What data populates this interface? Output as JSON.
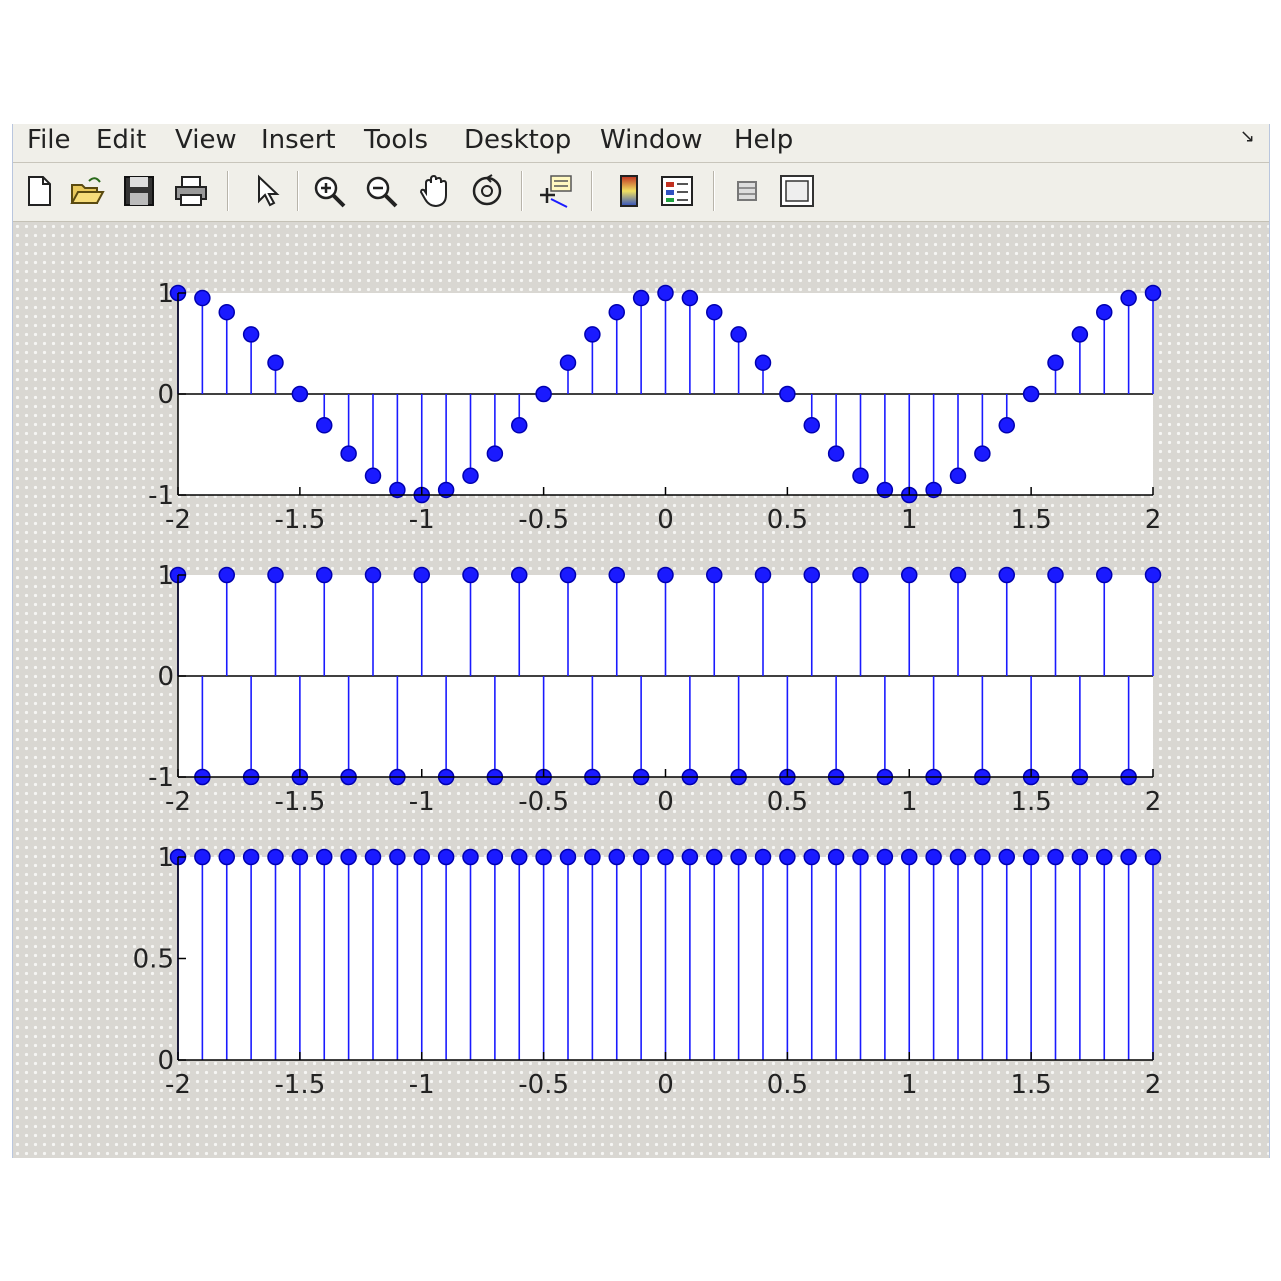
{
  "window": {
    "menu": [
      "File",
      "Edit",
      "View",
      "Insert",
      "Tools",
      "Desktop",
      "Window",
      "Help"
    ],
    "menu_corner_icon": "dock-arrow-icon"
  },
  "toolbar": {
    "buttons": [
      {
        "name": "new-figure-button",
        "icon": "new-document-icon"
      },
      {
        "name": "open-file-button",
        "icon": "open-folder-icon"
      },
      {
        "name": "save-figure-button",
        "icon": "floppy-disk-icon"
      },
      {
        "name": "print-figure-button",
        "icon": "printer-icon"
      },
      {
        "name": "edit-plot-button",
        "icon": "arrow-cursor-icon"
      },
      {
        "name": "zoom-in-button",
        "icon": "zoom-in-icon"
      },
      {
        "name": "zoom-out-button",
        "icon": "zoom-out-icon"
      },
      {
        "name": "pan-button",
        "icon": "hand-icon"
      },
      {
        "name": "rotate-3d-button",
        "icon": "rotate-icon"
      },
      {
        "name": "data-cursor-button",
        "icon": "data-cursor-icon"
      },
      {
        "name": "insert-colorbar-button",
        "icon": "colorbar-icon"
      },
      {
        "name": "insert-legend-button",
        "icon": "legend-icon"
      },
      {
        "name": "hide-plot-tools-button",
        "icon": "hide-tools-icon"
      },
      {
        "name": "show-plot-tools-button",
        "icon": "show-tools-icon"
      }
    ]
  },
  "colors": {
    "stem": "#1a1aff",
    "axes_bg": "#ffffff",
    "figure_bg": "#d9d7d2"
  },
  "chart_data": [
    {
      "type": "stem",
      "x": [
        -2,
        -1.9,
        -1.8,
        -1.7,
        -1.6,
        -1.5,
        -1.4,
        -1.3,
        -1.2,
        -1.1,
        -1,
        -0.9,
        -0.8,
        -0.7,
        -0.6,
        -0.5,
        -0.4,
        -0.3,
        -0.2,
        -0.1,
        0,
        0.1,
        0.2,
        0.3,
        0.4,
        0.5,
        0.6,
        0.7,
        0.8,
        0.9,
        1,
        1.1,
        1.2,
        1.3,
        1.4,
        1.5,
        1.6,
        1.7,
        1.8,
        1.9,
        2
      ],
      "y": [
        1,
        0.95,
        0.81,
        0.59,
        0.31,
        0,
        -0.31,
        -0.59,
        -0.81,
        -0.95,
        -1,
        -0.95,
        -0.81,
        -0.59,
        -0.31,
        0,
        0.31,
        0.59,
        0.81,
        0.95,
        1,
        0.95,
        0.81,
        0.59,
        0.31,
        0,
        -0.31,
        -0.59,
        -0.81,
        -0.95,
        -1,
        -0.95,
        -0.81,
        -0.59,
        -0.31,
        0,
        0.31,
        0.59,
        0.81,
        0.95,
        1
      ],
      "xlim": [
        -2,
        2
      ],
      "ylim": [
        -1,
        1
      ],
      "xticks": [
        "-2",
        "-1.5",
        "-1",
        "-0.5",
        "0",
        "0.5",
        "1",
        "1.5",
        "2"
      ],
      "yticks": [
        "-1",
        "0",
        "1"
      ],
      "marker": "filled circle"
    },
    {
      "type": "stem",
      "x": [
        -2,
        -1.9,
        -1.8,
        -1.7,
        -1.6,
        -1.5,
        -1.4,
        -1.3,
        -1.2,
        -1.1,
        -1,
        -0.9,
        -0.8,
        -0.7,
        -0.6,
        -0.5,
        -0.4,
        -0.3,
        -0.2,
        -0.1,
        0,
        0.1,
        0.2,
        0.3,
        0.4,
        0.5,
        0.6,
        0.7,
        0.8,
        0.9,
        1,
        1.1,
        1.2,
        1.3,
        1.4,
        1.5,
        1.6,
        1.7,
        1.8,
        1.9,
        2
      ],
      "y": [
        1,
        -1,
        1,
        -1,
        1,
        -1,
        1,
        -1,
        1,
        -1,
        1,
        -1,
        1,
        -1,
        1,
        -1,
        1,
        -1,
        1,
        -1,
        1,
        -1,
        1,
        -1,
        1,
        -1,
        1,
        -1,
        1,
        -1,
        1,
        -1,
        1,
        -1,
        1,
        -1,
        1,
        -1,
        1,
        -1,
        1
      ],
      "xlim": [
        -2,
        2
      ],
      "ylim": [
        -1,
        1
      ],
      "xticks": [
        "-2",
        "-1.5",
        "-1",
        "-0.5",
        "0",
        "0.5",
        "1",
        "1.5",
        "2"
      ],
      "yticks": [
        "-1",
        "0",
        "1"
      ],
      "marker": "filled circle"
    },
    {
      "type": "stem",
      "x": [
        -2,
        -1.9,
        -1.8,
        -1.7,
        -1.6,
        -1.5,
        -1.4,
        -1.3,
        -1.2,
        -1.1,
        -1,
        -0.9,
        -0.8,
        -0.7,
        -0.6,
        -0.5,
        -0.4,
        -0.3,
        -0.2,
        -0.1,
        0,
        0.1,
        0.2,
        0.3,
        0.4,
        0.5,
        0.6,
        0.7,
        0.8,
        0.9,
        1,
        1.1,
        1.2,
        1.3,
        1.4,
        1.5,
        1.6,
        1.7,
        1.8,
        1.9,
        2
      ],
      "y": [
        1,
        1,
        1,
        1,
        1,
        1,
        1,
        1,
        1,
        1,
        1,
        1,
        1,
        1,
        1,
        1,
        1,
        1,
        1,
        1,
        1,
        1,
        1,
        1,
        1,
        1,
        1,
        1,
        1,
        1,
        1,
        1,
        1,
        1,
        1,
        1,
        1,
        1,
        1,
        1,
        1
      ],
      "xlim": [
        -2,
        2
      ],
      "ylim": [
        0,
        1
      ],
      "xticks": [
        "-2",
        "-1.5",
        "-1",
        "-0.5",
        "0",
        "0.5",
        "1",
        "1.5",
        "2"
      ],
      "yticks": [
        "0",
        "0.5",
        "1"
      ],
      "marker": "filled circle"
    }
  ]
}
